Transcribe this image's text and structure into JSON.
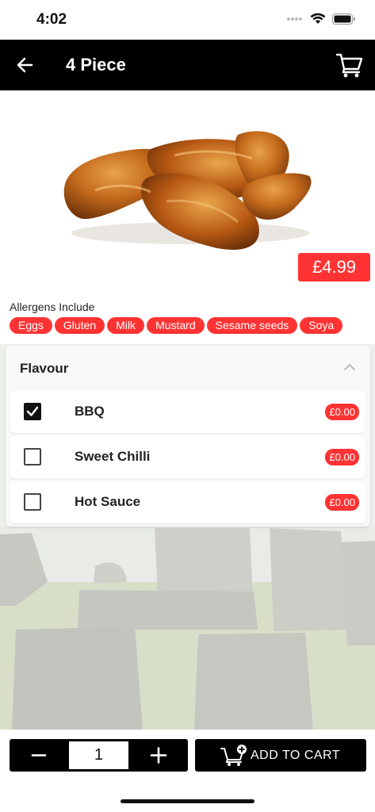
{
  "status_bar": {
    "time": "4:02",
    "signal_icon": "signal-dots-icon",
    "wifi_icon": "wifi-icon",
    "battery_icon": "battery-icon"
  },
  "header": {
    "title": "4 Piece",
    "back_icon": "arrow-left-icon",
    "cart_icon": "cart-icon"
  },
  "product": {
    "image": "chicken-wings",
    "price": "£4.99"
  },
  "allergens": {
    "title": "Allergens Include",
    "items": [
      "Eggs",
      "Gluten",
      "Milk",
      "Mustard",
      "Sesame seeds",
      "Soya"
    ]
  },
  "options": {
    "title": "Flavour",
    "expanded": true,
    "items": [
      {
        "label": "BBQ",
        "price": "£0.00",
        "checked": true
      },
      {
        "label": "Sweet Chilli",
        "price": "£0.00",
        "checked": false
      },
      {
        "label": "Hot Sauce",
        "price": "£0.00",
        "checked": false
      }
    ]
  },
  "footer": {
    "quantity": "1",
    "add_to_cart_label": "ADD TO CART"
  },
  "colors": {
    "accent": "#ff3333",
    "bar": "#000000"
  }
}
